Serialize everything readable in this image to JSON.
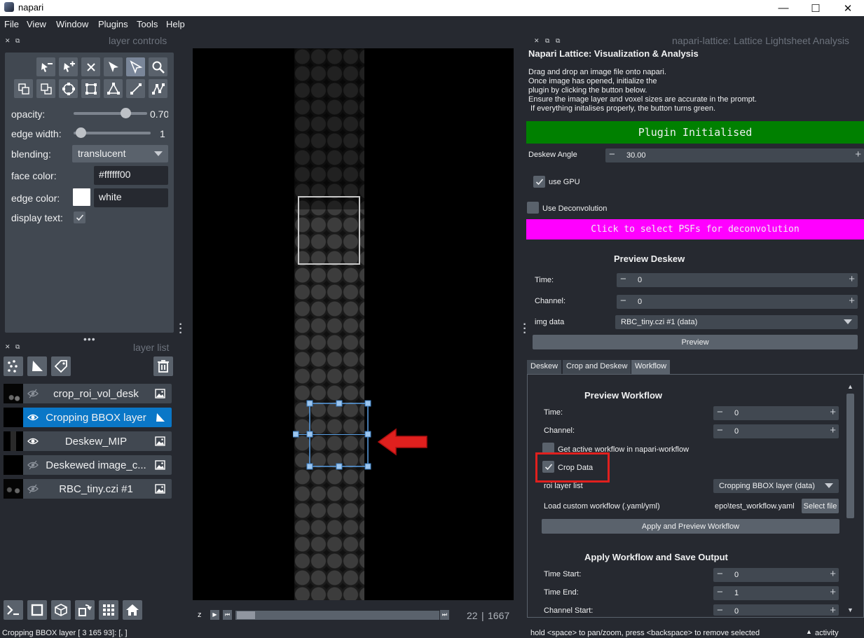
{
  "window": {
    "title": "napari",
    "minimize": "—",
    "maximize": "☐",
    "close": "✕"
  },
  "menu": [
    "File",
    "View",
    "Window",
    "Plugins",
    "Tools",
    "Help"
  ],
  "layer_controls": {
    "header": "layer controls",
    "opacity_label": "opacity:",
    "opacity_value": "0.70",
    "opacity_level": 0.7,
    "edge_width_label": "edge width:",
    "edge_width_value": "1",
    "blending_label": "blending:",
    "blending_value": "translucent",
    "face_color_label": "face color:",
    "face_color_value": "#ffffff00",
    "edge_color_label": "edge color:",
    "edge_color_value": "white",
    "display_text_label": "display text:"
  },
  "layer_list": {
    "header": "layer list",
    "layers": [
      {
        "name": "crop_roi_vol_desk",
        "visible": false,
        "selected": false,
        "type": "image-icon"
      },
      {
        "name": "Cropping BBOX layer",
        "visible": true,
        "selected": true,
        "type": "shapes-icon"
      },
      {
        "name": "Deskew_MIP",
        "visible": true,
        "selected": false,
        "type": "image-icon"
      },
      {
        "name": "Deskewed image_c...",
        "visible": false,
        "selected": false,
        "type": "image-icon"
      },
      {
        "name": "RBC_tiny.czi #1",
        "visible": false,
        "selected": false,
        "type": "image-icon"
      }
    ]
  },
  "viewer": {
    "axis_label": "z",
    "slice_current": "22",
    "slice_total": "1667"
  },
  "plugin": {
    "dock_title": "napari-lattice: Lattice Lightsheet Analysis",
    "title": "Napari Lattice: Visualization & Analysis",
    "instructions": [
      "Drag and drop an image file onto napari.",
      "Once image has opened, initialize the",
      "plugin by clicking the button below.",
      "Ensure the image layer and voxel sizes are accurate in the prompt.",
      " If everything initalises properly, the button turns green."
    ],
    "init_button": "Plugin Initialised",
    "deskew_angle_label": "Deskew Angle",
    "deskew_angle_value": "30.00",
    "use_gpu_label": "use GPU",
    "use_deconv_label": "Use Deconvolution",
    "psf_button": "Click to select PSFs for deconvolution",
    "preview_deskew_title": "Preview Deskew",
    "time_label": "Time:",
    "time_value": "0",
    "channel_label": "Channel:",
    "channel_value": "0",
    "img_data_label": "img data",
    "img_data_value": "RBC_tiny.czi #1 (data)",
    "preview_button": "Preview",
    "tabs": [
      "Deskew",
      "Crop and Deskew",
      "Workflow"
    ],
    "workflow": {
      "preview_title": "Preview Workflow",
      "time_label": "Time:",
      "time_value": "0",
      "channel_label": "Channel:",
      "channel_value": "0",
      "get_active_label": "Get active workflow in napari-workflow",
      "crop_data_label": "Crop Data",
      "roi_label": "roi layer list",
      "roi_value": "Cropping BBOX layer (data)",
      "load_label": "Load custom workflow (.yaml/yml)",
      "load_value": "epo\\test_workflow.yaml",
      "select_file": "Select file",
      "apply_preview_button": "Apply and Preview Workflow",
      "apply_title": "Apply Workflow and Save Output",
      "time_start_label": "Time Start:",
      "time_start_value": "0",
      "time_end_label": "Time End:",
      "time_end_value": "1",
      "channel_start_label": "Channel Start:",
      "channel_start_value": "0"
    }
  },
  "status": {
    "left": "Cropping BBOX layer [  3 165  93]: [, ]",
    "center": "hold <space> to pan/zoom, press <backspace> to remove selected",
    "activity": "activity"
  },
  "colors": {
    "init_button": "#008000",
    "psf_button": "#ff00ff",
    "selected_layer": "#0a77c7",
    "highlight": "#e0201e"
  }
}
